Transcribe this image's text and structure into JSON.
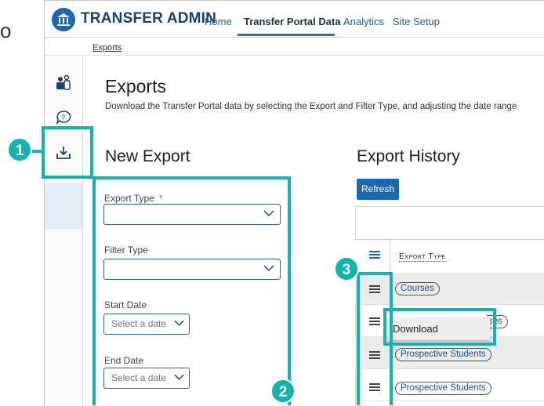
{
  "fragment": "o.",
  "app": {
    "brand": "TRANSFER ADMIN"
  },
  "nav": {
    "items": [
      "Home",
      "Transfer Portal Data",
      "Analytics",
      "Site Setup"
    ],
    "active": "Transfer Portal Data"
  },
  "breadcrumb": "Exports",
  "sidebar": {
    "icons": [
      "users-icon",
      "question-icon",
      "download-icon"
    ],
    "active": "download-icon"
  },
  "page": {
    "title": "Exports",
    "description": "Download the Transfer Portal data by selecting the Export and Filter Type, and adjusting the date range"
  },
  "new_export": {
    "heading": "New Export",
    "export_type_label": "Export Type",
    "required_mark": "*",
    "filter_type_label": "Filter Type",
    "start_date_label": "Start Date",
    "start_date_placeholder": "Select a date",
    "end_date_label": "End Date",
    "end_date_placeholder": "Select a date"
  },
  "export_history": {
    "heading": "Export History",
    "refresh_label": "Refresh",
    "column_header": "Export Type",
    "rows": [
      "Courses",
      "Courses",
      "Prospective Students",
      "Prospective Students"
    ],
    "row2_visible_fragment": "ses"
  },
  "context_menu": {
    "items": [
      "Download"
    ]
  },
  "callouts": [
    "1",
    "2",
    "3"
  ],
  "colors": {
    "accent": "#1c67b3",
    "callout": "#14b3b0",
    "brand_text": "#1c3f6e",
    "required": "#d9534f"
  }
}
